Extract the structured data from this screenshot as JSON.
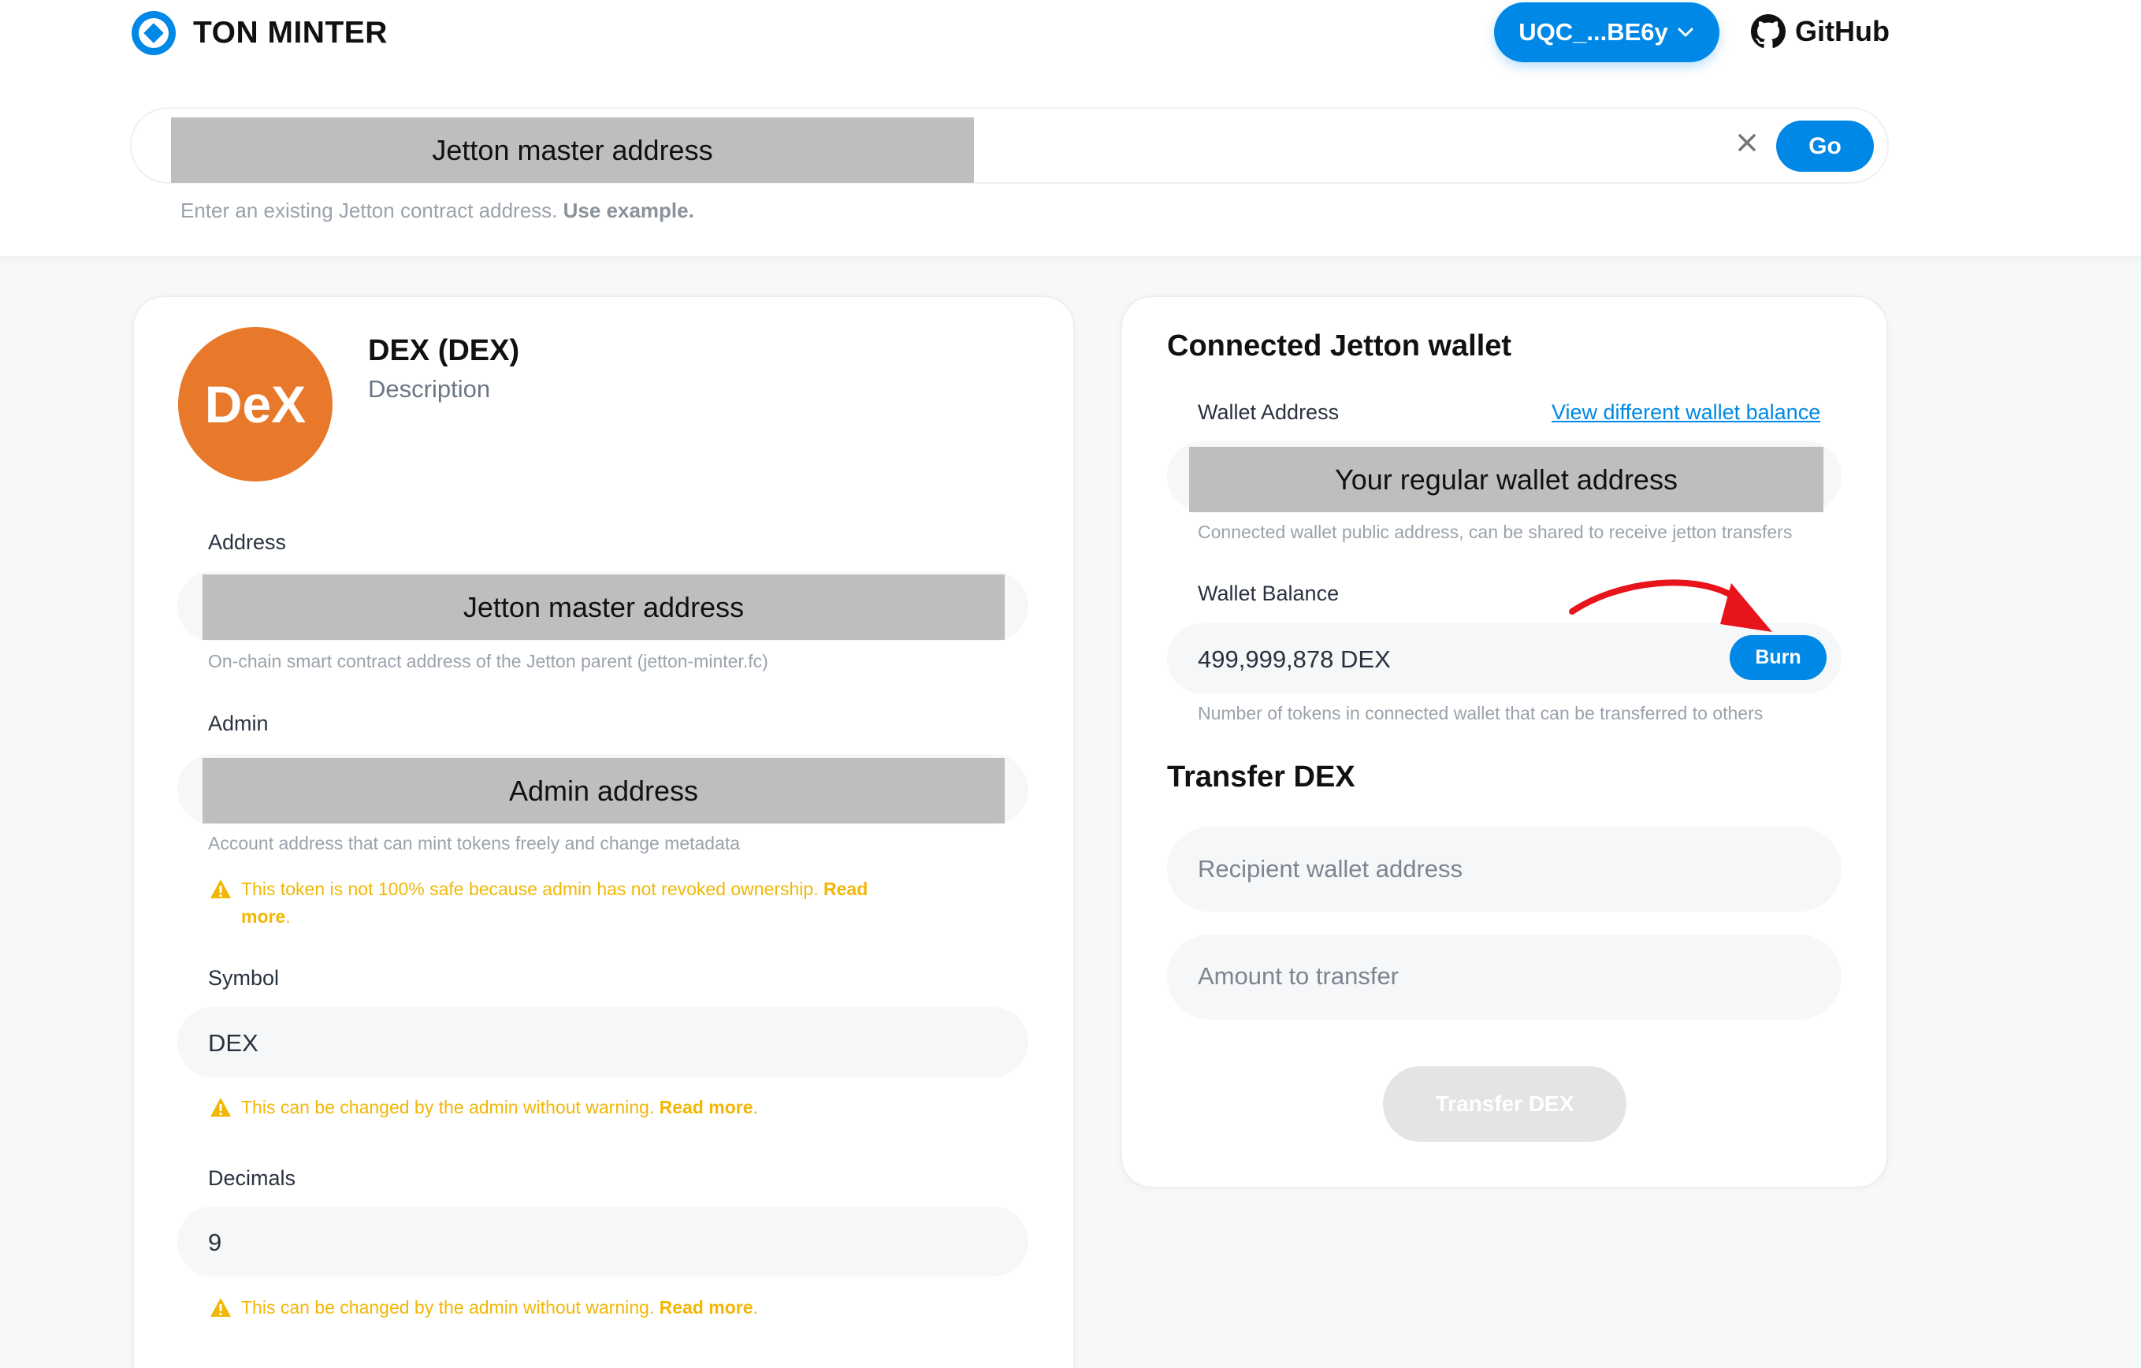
{
  "header": {
    "app_name": "TON MINTER",
    "wallet_button": "UQC_...BE6y",
    "github_label": "GitHub"
  },
  "search": {
    "placeholder": "Jetton master address",
    "go_label": "Go",
    "hint_prefix": "Enter an existing Jetton contract address.",
    "hint_link": "Use example."
  },
  "token": {
    "avatar_text": "DeX",
    "name": "DEX (DEX)",
    "description": "Description",
    "address_label": "Address",
    "address_value": "Jetton master address",
    "address_hint": "On-chain smart contract address of the Jetton parent (jetton-minter.fc)",
    "admin_label": "Admin",
    "admin_value": "Admin address",
    "admin_hint": "Account address that can mint tokens freely and change metadata",
    "admin_warning": "This token is not 100% safe because admin has not revoked ownership.",
    "admin_warning_link_1": "Read",
    "admin_warning_link_2": "more",
    "admin_warning_end": ".",
    "symbol_label": "Symbol",
    "symbol_value": "DEX",
    "symbol_warning": "This can be changed by the admin without warning.",
    "symbol_warning_link": "Read more",
    "decimals_label": "Decimals",
    "decimals_value": "9",
    "decimals_warning": "This can be changed by the admin without warning.",
    "decimals_warning_link": "Read more",
    "warning_period": "."
  },
  "wallet": {
    "title": "Connected Jetton wallet",
    "address_label": "Wallet Address",
    "view_different_link": "View different wallet balance",
    "address_value": "Your regular wallet address",
    "address_hint": "Connected wallet public address, can be shared to receive jetton transfers",
    "balance_label": "Wallet Balance",
    "balance_value": "499,999,878 DEX",
    "burn_label": "Burn",
    "balance_hint": "Number of tokens in connected wallet that can be transferred to others"
  },
  "transfer": {
    "title": "Transfer DEX",
    "recipient_placeholder": "Recipient wallet address",
    "amount_placeholder": "Amount to transfer",
    "button_label": "Transfer DEX"
  },
  "colors": {
    "accent": "#0088e6",
    "warning": "#f2b705",
    "avatar": "#e8792b",
    "annotation_arrow": "#e8141b"
  },
  "icons": [
    "ton-logo-icon",
    "chevron-down-icon",
    "github-icon",
    "close-icon",
    "warning-icon",
    "red-arrow-annotation"
  ]
}
